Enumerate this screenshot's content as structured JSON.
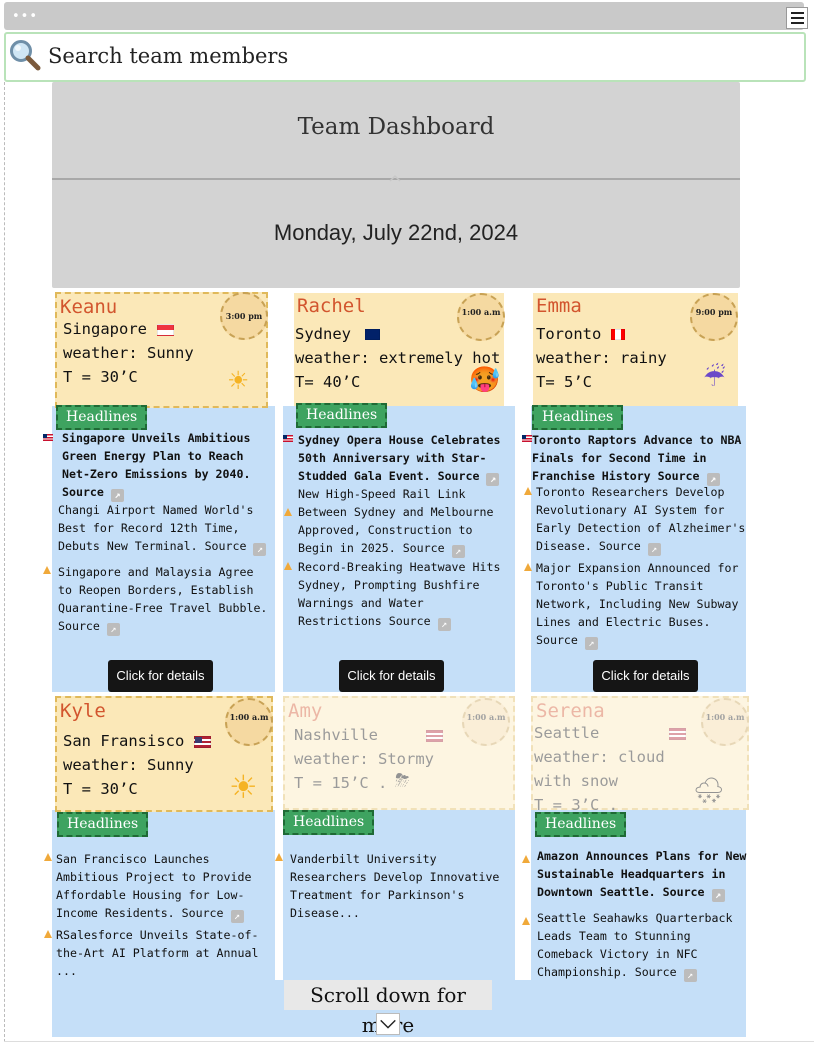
{
  "window": {
    "dots": "•••",
    "menu_icon": "hamburger-icon"
  },
  "search": {
    "placeholder": "Search team members",
    "icon": "magnifier-icon"
  },
  "header": {
    "title": "Team Dashboard",
    "date": "Monday, July 22nd, 2024",
    "collapse_icon": "chevron-up-icon"
  },
  "members": [
    {
      "name": "Keanu",
      "city": "Singapore",
      "weather": "weather: Sunny",
      "temp": "T = 30’C",
      "time": "3:00 pm",
      "weather_icon": "☀",
      "flag_colors": [
        "#ef3340",
        "#ffffff"
      ],
      "headlines_label": "Headlines",
      "headlines": [
        "Singapore Unveils Ambitious Green Energy Plan to Reach Net-Zero Emissions by 2040. Source",
        "Changi Airport Named World's Best for Record 12th Time, Debuts New Terminal. Source",
        "Singapore and Malaysia Agree to Reopen Borders, Establish Quarantine-Free Travel Bubble. Source"
      ],
      "button": "Click for details"
    },
    {
      "name": "Rachel",
      "city": "Sydney",
      "weather": "weather: extremely hot",
      "temp": "T= 40’C",
      "time": "1:00 a.m",
      "weather_icon": "🥵",
      "flag_colors": [
        "#012169",
        "#ffffff"
      ],
      "headlines_label": "Headlines",
      "headlines": [
        "Sydney Opera House Celebrates 50th Anniversary with Star-Studded Gala Event. Source",
        "New High-Speed Rail Link Between Sydney and Melbourne Approved, Construction to Begin in 2025. Source",
        "Record-Breaking Heatwave Hits Sydney, Prompting Bushfire Warnings and Water Restrictions Source"
      ],
      "button": "Click for details"
    },
    {
      "name": "Emma",
      "city": "Toronto",
      "weather": "weather: rainy",
      "temp": "T= 5’C",
      "time": "9:00 pm",
      "weather_icon": "☔",
      "flag_colors": [
        "#ff0000",
        "#ffffff"
      ],
      "headlines_label": "Headlines",
      "headlines": [
        "Toronto Raptors Advance to NBA Finals for Second Time in Franchise History Source",
        "Toronto Researchers Develop Revolutionary AI System for Early Detection of Alzheimer's Disease. Source",
        "Major Expansion Announced for Toronto's Public Transit Network, Including New Subway Lines and Electric Buses. Source"
      ],
      "button": "Click for details"
    },
    {
      "name": "Kyle",
      "city": "San Fransisco",
      "weather": "weather: Sunny",
      "temp": "T = 30’C",
      "time": "1:00 a.m",
      "weather_icon": "☀",
      "flag_colors": [
        "#b22234",
        "#3c3b6e"
      ],
      "headlines_label": "Headlines",
      "headlines": [
        "San Francisco Launches Ambitious Project to Provide Affordable Housing for Low-Income Residents. Source",
        "RSalesforce Unveils State-of-the-Art AI Platform at Annual ..."
      ]
    },
    {
      "name": "Amy",
      "city": "Nashville",
      "weather": "weather: Stormy",
      "temp": "T = 15’C .",
      "time": "1:00 a.m",
      "weather_icon": "⛈",
      "flag_colors": [
        "#b22234",
        "#3c3b6e"
      ],
      "headlines_label": "Headlines",
      "headlines": [
        "Vanderbilt University Researchers Develop Innovative Treatment for Parkinson's Disease..."
      ]
    },
    {
      "name": "Serena",
      "city": "Seattle",
      "weather_lines": [
        "weather: cloud",
        "with snow"
      ],
      "temp": "T = 3’C .",
      "time": "1:00 a.m",
      "weather_icon": "🌨",
      "flag_colors": [
        "#b22234",
        "#3c3b6e"
      ],
      "headlines_label": "Headlines",
      "headlines": [
        "Amazon Announces Plans for New Sustainable Headquarters in Downtown Seattle. Source",
        "Seattle Seahawks Quarterback Leads Team to Stunning Comeback Victory in NFC Championship. Source"
      ]
    }
  ],
  "footer": {
    "scroll_hint": "Scroll down for more",
    "scroll_icon": "chevron-down-icon"
  }
}
